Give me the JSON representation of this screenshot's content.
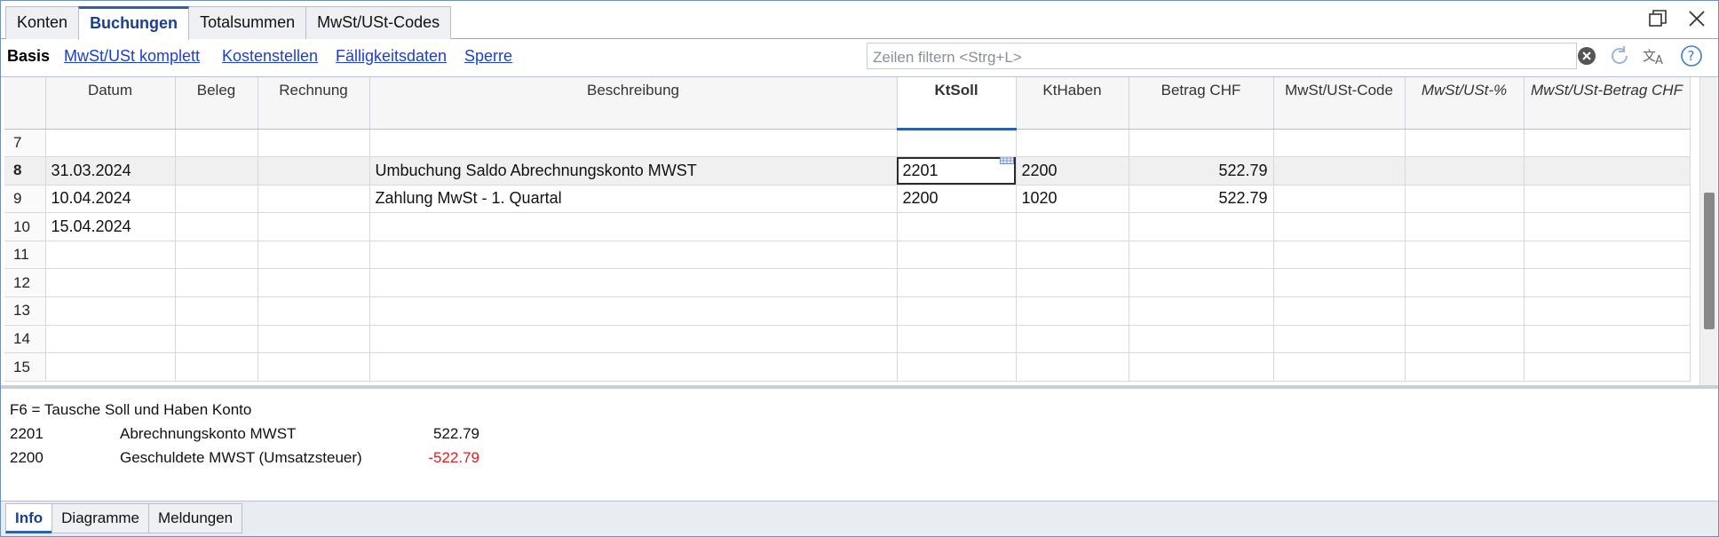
{
  "tabs": [
    "Konten",
    "Buchungen",
    "Totalsummen",
    "MwSt/USt-Codes"
  ],
  "subnav": {
    "basis": "Basis",
    "links": [
      "MwSt/USt komplett",
      "Kostenstellen",
      "Fälligkeitsdaten",
      "Sperre"
    ]
  },
  "filter": {
    "placeholder": "Zeilen filtern <Strg+L>"
  },
  "grid": {
    "columns": [
      "",
      "Datum",
      "Beleg",
      "Rechnung",
      "Beschreibung",
      "KtSoll",
      "KtHaben",
      "Betrag CHF",
      "MwSt/USt-Code",
      "MwSt/USt-%",
      "MwSt/USt-Betrag CHF"
    ],
    "rows": [
      {
        "n": "7",
        "datum": "",
        "beleg": "",
        "rechnung": "",
        "beschreibung": "",
        "ktsoll": "",
        "kthaben": "",
        "betrag": ""
      },
      {
        "n": "8",
        "datum": "31.03.2024",
        "beleg": "",
        "rechnung": "",
        "beschreibung": "Umbuchung Saldo Abrechnungskonto MWST",
        "ktsoll": "2201",
        "kthaben": "2200",
        "betrag": "522.79"
      },
      {
        "n": "9",
        "datum": "10.04.2024",
        "beleg": "",
        "rechnung": "",
        "beschreibung": "Zahlung MwSt - 1. Quartal",
        "ktsoll": "2200",
        "kthaben": "1020",
        "betrag": "522.79"
      },
      {
        "n": "10",
        "datum": "15.04.2024",
        "beleg": "",
        "rechnung": "",
        "beschreibung": "",
        "ktsoll": "",
        "kthaben": "",
        "betrag": ""
      },
      {
        "n": "11",
        "datum": "",
        "beleg": "",
        "rechnung": "",
        "beschreibung": "",
        "ktsoll": "",
        "kthaben": "",
        "betrag": ""
      },
      {
        "n": "12",
        "datum": "",
        "beleg": "",
        "rechnung": "",
        "beschreibung": "",
        "ktsoll": "",
        "kthaben": "",
        "betrag": ""
      },
      {
        "n": "13",
        "datum": "",
        "beleg": "",
        "rechnung": "",
        "beschreibung": "",
        "ktsoll": "",
        "kthaben": "",
        "betrag": ""
      },
      {
        "n": "14",
        "datum": "",
        "beleg": "",
        "rechnung": "",
        "beschreibung": "",
        "ktsoll": "",
        "kthaben": "",
        "betrag": ""
      },
      {
        "n": "15",
        "datum": "",
        "beleg": "",
        "rechnung": "",
        "beschreibung": "",
        "ktsoll": "",
        "kthaben": "",
        "betrag": ""
      }
    ]
  },
  "info": {
    "hint": "F6 = Tausche Soll und Haben Konto",
    "lines": [
      {
        "account": "2201",
        "name": "Abrechnungskonto MWST",
        "amount": "522.79"
      },
      {
        "account": "2200",
        "name": "Geschuldete MWST (Umsatzsteuer)",
        "amount": "-522.79"
      }
    ]
  },
  "bottom_tabs": [
    "Info",
    "Diagramme",
    "Meldungen"
  ],
  "colors": {
    "accent": "#2d5fb0",
    "link": "#1a3fd8",
    "negative": "#e02020"
  },
  "icons": [
    "restore-window-icon",
    "close-icon",
    "clear-filter-icon",
    "refresh-icon",
    "translate-icon",
    "help-icon",
    "calendar-icon"
  ]
}
